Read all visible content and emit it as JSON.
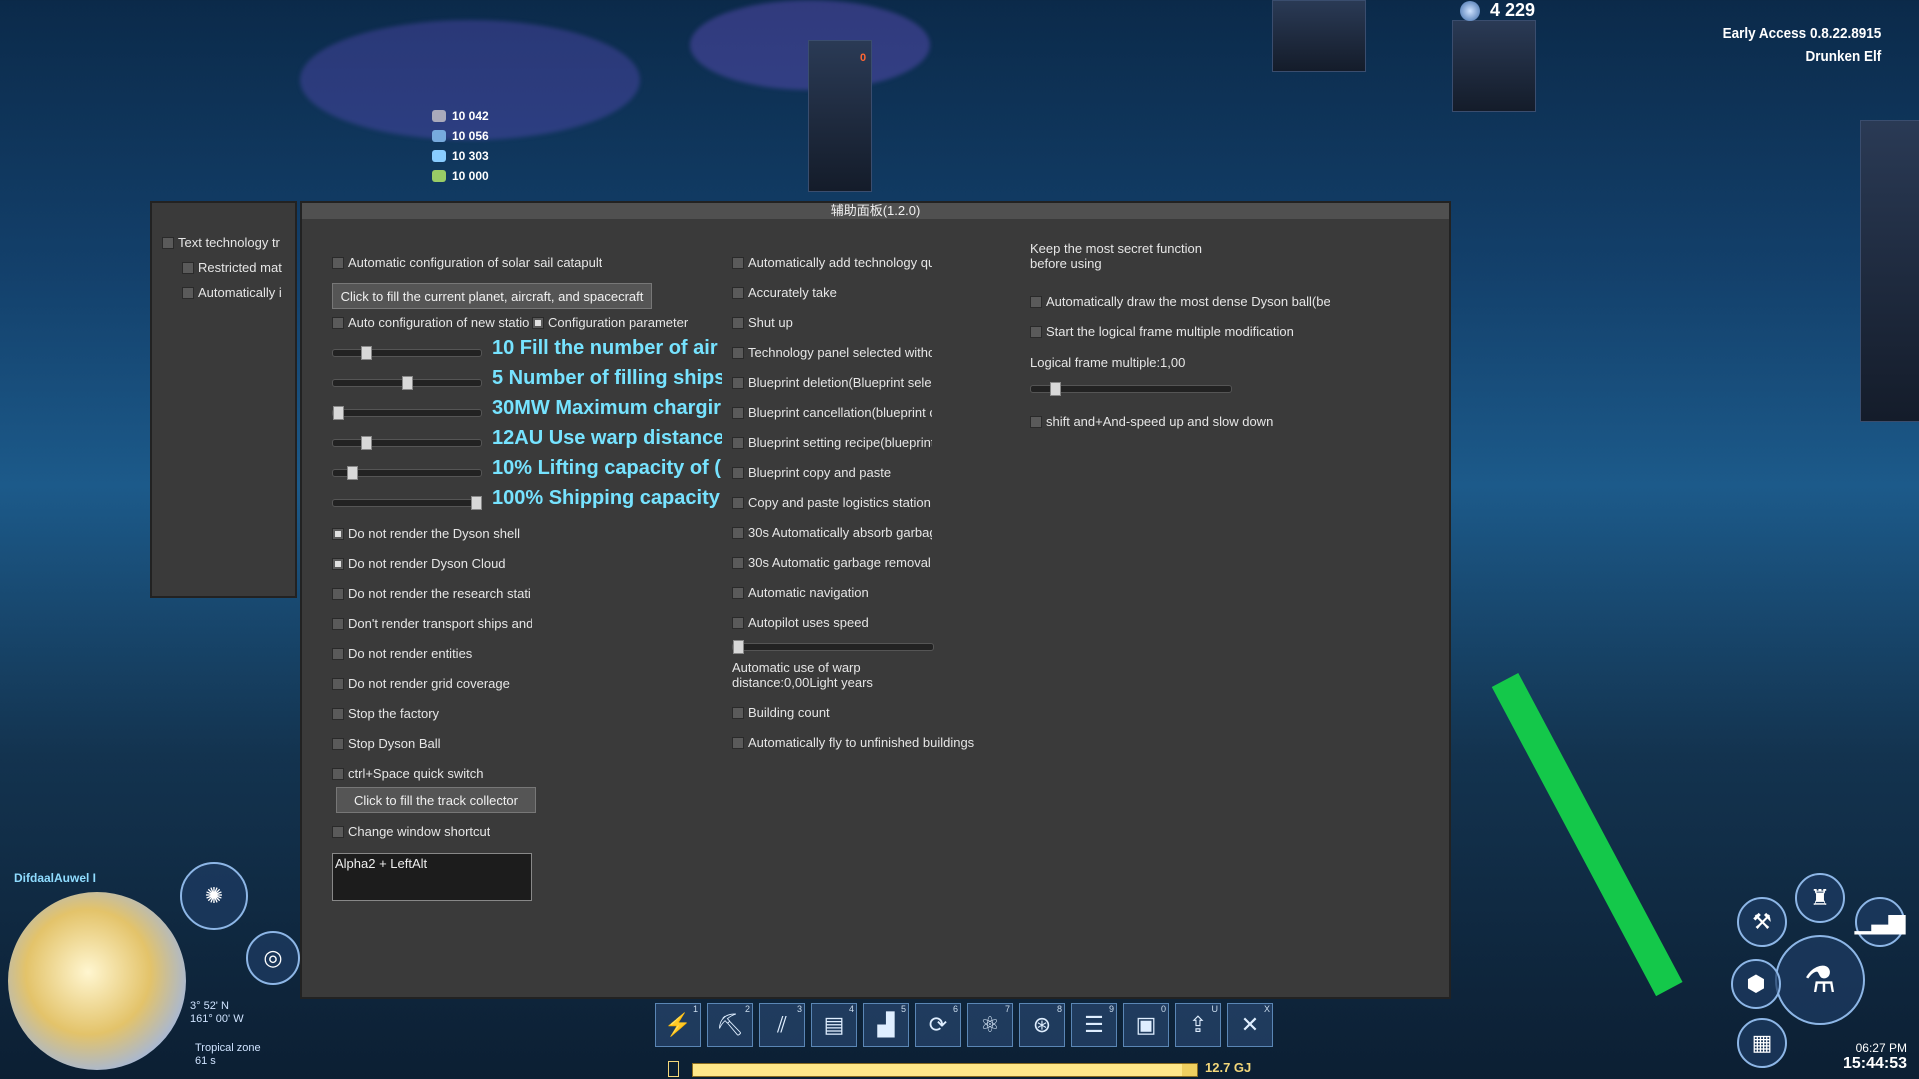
{
  "hud": {
    "resources": [
      "10 042",
      "10 056",
      "10 303",
      "10 000"
    ],
    "top_count": "4 229",
    "station_count": "0",
    "version": "Early Access 0.8.22.8915",
    "player": "Drunken Elf"
  },
  "side_panel": {
    "items": [
      {
        "label": "Text technology tr",
        "checked": false
      },
      {
        "label": "Restricted mat",
        "checked": false
      },
      {
        "label": "Automatically i",
        "checked": false
      }
    ]
  },
  "panel": {
    "title": "辅助面板(1.2.0)",
    "col1": {
      "solar_sail": "Automatic configuration of solar sail catapult",
      "fill_button": "Click to fill the current planet, aircraft, and spacecraft",
      "auto_station": "Auto configuration of new statio",
      "config_param": "Configuration parameter",
      "sliders": [
        {
          "label": "10 Fill the number of air",
          "value": 0.2
        },
        {
          "label": "5 Number of filling ships",
          "value": 0.5
        },
        {
          "label": "30MW Maximum chargir",
          "value": 0.0
        },
        {
          "label": "12AU Use warp distance",
          "value": 0.2
        },
        {
          "label": "10% Lifting capacity of (",
          "value": 0.1
        },
        {
          "label": "100% Shipping capacity",
          "value": 1.0
        }
      ],
      "checks": [
        {
          "label": "Do not render the Dyson shell",
          "checked": true
        },
        {
          "label": "Do not render Dyson Cloud",
          "checked": true
        },
        {
          "label": "Do not render the research stati",
          "checked": false
        },
        {
          "label": "Don't render transport ships and",
          "checked": false
        },
        {
          "label": "Do not render entities",
          "checked": false
        },
        {
          "label": "Do not render grid coverage",
          "checked": false
        },
        {
          "label": "Stop the factory",
          "checked": false
        },
        {
          "label": "Stop Dyson Ball",
          "checked": false
        },
        {
          "label": "ctrl+Space quick switch",
          "checked": false
        }
      ],
      "track_button": "Click to fill the track collector",
      "shortcut_check": "Change window shortcut",
      "shortcut_value": "Alpha2 + LeftAlt"
    },
    "col2": {
      "checks": [
        {
          "label": "Automatically add technology qu",
          "checked": false
        },
        {
          "label": "Accurately take",
          "checked": false
        },
        {
          "label": "Shut up",
          "checked": false
        },
        {
          "label": "Technology panel selected witho",
          "checked": false
        },
        {
          "label": "Blueprint deletion(Blueprint sele",
          "checked": false
        },
        {
          "label": "Blueprint cancellation(blueprint c",
          "checked": false
        },
        {
          "label": "Blueprint setting recipe(blueprint",
          "checked": false
        },
        {
          "label": "Blueprint copy and paste",
          "checked": false
        },
        {
          "label": "Copy and paste logistics station",
          "checked": false
        },
        {
          "label": "30s Automatically absorb garbag",
          "checked": false
        },
        {
          "label": "30s Automatic garbage removal",
          "checked": false
        },
        {
          "label": "Automatic navigation",
          "checked": false
        },
        {
          "label": "Autopilot uses speed",
          "checked": false
        }
      ],
      "speed_value": 0.0,
      "warp_text": "Automatic use of warp distance:0,00Light years",
      "building_count": "Building count",
      "fly_unfinished": "Automatically fly to unfinished buildings"
    },
    "col3": {
      "secret_text": "Keep the most secret function before using",
      "dyson_ball": "Automatically draw the most dense Dyson ball(be",
      "logic_frame": "Start the logical frame multiple modification",
      "logic_label": "Logical frame multiple:1,00",
      "logic_value": 0.1,
      "shift_speed": "shift and+And-speed up and slow down"
    }
  },
  "toolbar": {
    "tools": [
      {
        "key": "1",
        "icon": "⚡",
        "name": "power-icon"
      },
      {
        "key": "2",
        "icon": "⛏",
        "name": "pickaxe-icon"
      },
      {
        "key": "3",
        "icon": "⫽",
        "name": "belt-icon"
      },
      {
        "key": "4",
        "icon": "▤",
        "name": "storage-icon"
      },
      {
        "key": "5",
        "icon": "▟",
        "name": "factory-icon"
      },
      {
        "key": "6",
        "icon": "⟳",
        "name": "refine-icon"
      },
      {
        "key": "7",
        "icon": "⚛",
        "name": "chemical-icon"
      },
      {
        "key": "8",
        "icon": "⊛",
        "name": "dyson-icon"
      },
      {
        "key": "9",
        "icon": "☰",
        "name": "logistics-icon"
      },
      {
        "key": "0",
        "icon": "▣",
        "name": "blueprint-icon"
      },
      {
        "key": "U",
        "icon": "⇪",
        "name": "upgrade-icon"
      },
      {
        "key": "X",
        "icon": "✕",
        "name": "dismantle-icon"
      }
    ],
    "energy": "12.7 GJ",
    "energy_level": 0.97
  },
  "planet": {
    "name": "DifdaalAuwel I",
    "coords": [
      "3° 52' N",
      "161° 00' W"
    ],
    "zone": "Tropical zone",
    "zone_time": "61 s"
  },
  "clock": {
    "time_small": "06:27 PM",
    "time_big": "15:44:53"
  },
  "colors": {
    "accent": "#76e3ff",
    "panel": "#3a3a3a",
    "energy": "#f0d060"
  }
}
